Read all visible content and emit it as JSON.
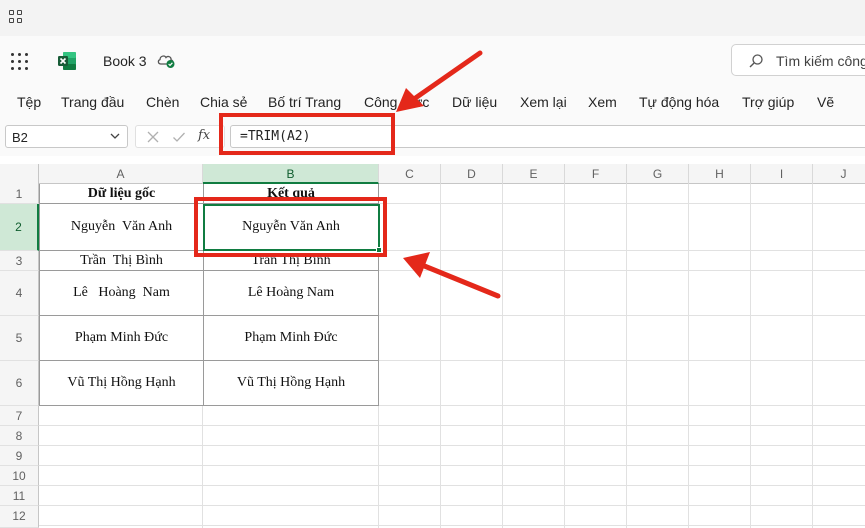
{
  "window": {
    "book_title": "Book 3"
  },
  "search": {
    "placeholder": "Tìm kiếm công"
  },
  "menu": [
    "Tệp",
    "Trang đầu",
    "Chèn",
    "Chia sẻ",
    "Bố trí Trang",
    "Công thức",
    "Dữ liệu",
    "Xem lại",
    "Xem",
    "Tự động hóa",
    "Trợ giúp",
    "Vẽ"
  ],
  "formula_bar": {
    "name_box": "B2",
    "fx_label": "fx",
    "formula": "=TRIM(A2)"
  },
  "columns": [
    "A",
    "B",
    "C",
    "D",
    "E",
    "F",
    "G",
    "H",
    "I",
    "J"
  ],
  "rows": [
    "1",
    "2",
    "3",
    "4",
    "5",
    "6",
    "7",
    "8",
    "9",
    "10",
    "11",
    "12"
  ],
  "cells": {
    "A1": "Dữ liệu gốc",
    "B1": "Kết quả",
    "A2": "Nguyễn  Văn Anh",
    "B2": "Nguyễn Văn Anh",
    "A3": "Trần  Thị Bình",
    "B3": "Trần Thị Bình",
    "A4": "Lê   Hoàng  Nam",
    "B4": "Lê Hoàng Nam",
    "A5": "Phạm Minh Đức",
    "B5": "Phạm Minh Đức",
    "A6": "Vũ Thị Hồng Hạnh",
    "B6": "Vũ Thị Hồng Hạnh"
  },
  "selection": {
    "active_column": "B",
    "active_row": "2"
  },
  "colors": {
    "excel_green": "#107c41",
    "annotation_red": "#e4281a"
  }
}
